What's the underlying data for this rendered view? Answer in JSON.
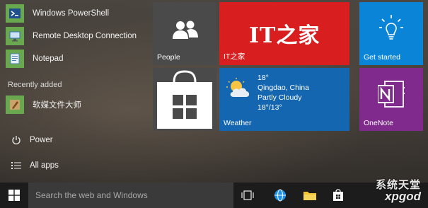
{
  "app_list": {
    "items": [
      {
        "label": "Windows PowerShell",
        "icon": "powershell-icon"
      },
      {
        "label": "Remote Desktop Connection",
        "icon": "remote-desktop-icon"
      },
      {
        "label": "Notepad",
        "icon": "notepad-icon"
      }
    ],
    "recently_added_label": "Recently added",
    "recent_items": [
      {
        "label": "软媒文件大师",
        "icon": "file-master-icon"
      }
    ]
  },
  "bottom_menu": {
    "power_label": "Power",
    "all_apps_label": "All apps"
  },
  "tiles": {
    "people": {
      "label": "People",
      "color": "#4a4a4a"
    },
    "ithome": {
      "label": "IT之家",
      "logo_text": "IT之家",
      "color": "#d81e1e"
    },
    "get_started": {
      "label": "Get started",
      "color": "#0a84d6"
    },
    "store": {
      "color": "#d9d9d9"
    },
    "weather": {
      "label": "Weather",
      "temperature": "18°",
      "city": "Qingdao, China",
      "condition": "Partly Cloudy",
      "range": "18°/13°",
      "color": "#1466b0"
    },
    "onenote": {
      "label": "OneNote",
      "color": "#7f2a8c"
    }
  },
  "taskbar": {
    "search_placeholder": "Search the web and Windows",
    "icons": [
      "start-icon",
      "task-view-icon",
      "edge-browser-icon",
      "file-explorer-icon",
      "store-icon"
    ]
  },
  "watermark": {
    "line1": "系统天堂",
    "line2": "xpgod"
  }
}
